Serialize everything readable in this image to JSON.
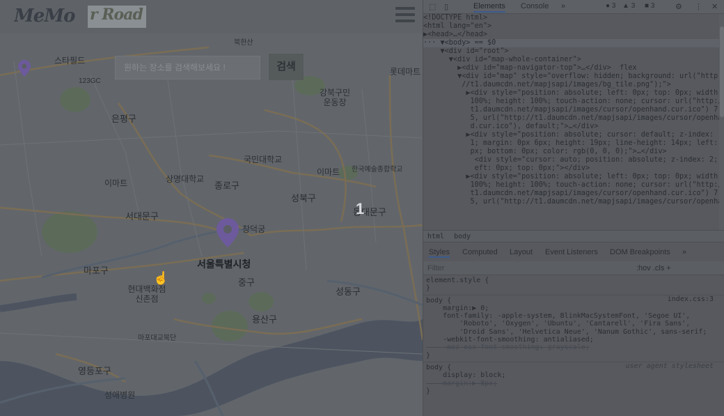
{
  "app": {
    "logo_text_1": "MeMo",
    "logo_text_2": "r Road",
    "search_placeholder": "원하는 장소를 검색해보세요 !",
    "search_button": "검색",
    "count_label": "1"
  },
  "map_labels": [
    {
      "text": "스타필드",
      "cls": "lbl"
    },
    {
      "text": "123GC",
      "cls": "lbl"
    },
    {
      "text": "이마트",
      "cls": "lbl"
    },
    {
      "text": "은평구",
      "cls": "lbl mid"
    },
    {
      "text": "국민대학교",
      "cls": "lbl"
    },
    {
      "text": "상명대학교",
      "cls": "lbl"
    },
    {
      "text": "종로구",
      "cls": "lbl mid"
    },
    {
      "text": "성북구",
      "cls": "lbl mid"
    },
    {
      "text": "서대문구",
      "cls": "lbl mid"
    },
    {
      "text": "창덕궁",
      "cls": "lbl"
    },
    {
      "text": "동대문구",
      "cls": "lbl mid"
    },
    {
      "text": "서울특별시청",
      "cls": "lbl big"
    },
    {
      "text": "마포구",
      "cls": "lbl mid"
    },
    {
      "text": "현대백화점 신촌점",
      "cls": "lbl"
    },
    {
      "text": "중구",
      "cls": "lbl mid"
    },
    {
      "text": "성동구",
      "cls": "lbl mid"
    },
    {
      "text": "영등포구",
      "cls": "lbl mid"
    },
    {
      "text": "용산구",
      "cls": "lbl mid"
    },
    {
      "text": "강북구민운동장",
      "cls": "lbl"
    },
    {
      "text": "롯데마트",
      "cls": "lbl"
    },
    {
      "text": "이마트",
      "cls": "lbl"
    },
    {
      "text": "한국예술종합학교",
      "cls": "lbl"
    },
    {
      "text": "성애병원",
      "cls": "lbl"
    },
    {
      "text": "마포대교북단",
      "cls": "lbl"
    },
    {
      "text": "북한산",
      "cls": "lbl"
    }
  ],
  "devtools": {
    "tabs": [
      "Elements",
      "Console"
    ],
    "more": "»",
    "errors": "3",
    "warnings": "3",
    "info": "3",
    "dom_lines": [
      "<!DOCTYPE html>",
      "<html lang=\"en\">",
      "▶<head>…</head>",
      "··· ▼<body> == $0",
      "    ▼<div id=\"root\">",
      "      ▼<div id=\"map-whole-container\">",
      "        ▶<div id=\"map-navigator-top\">…</div>  flex",
      "        ▼<div id=\"map\" style=\"overflow: hidden; background: url(\"http:",
      "         //t1.daumcdn.net/mapjsapi/images/bg_tile.png\");\">",
      "          ▶<div style=\"position: absolute; left: 0px; top: 0px; width:",
      "           100%; height: 100%; touch-action: none; cursor: url(\"http://",
      "           t1.daumcdn.net/mapjsapi/images/cursor/openhand.cur.ico\") 7",
      "           5, url(\"http://t1.daumcdn.net/mapjsapi/images/cursor/openhan",
      "           d.cur.ico\"), default;\">…</div>",
      "          ▶<div style=\"position: absolute; cursor: default; z-index:",
      "           1; margin: 0px 6px; height: 19px; line-height: 14px; left: 0",
      "           px; bottom: 0px; color: rgb(0, 0, 0);\">…</div>",
      "            <div style=\"cursor: auto; position: absolute; z-index: 2; l",
      "            eft: 0px; top: 0px;\"></div>",
      "          ▶<div style=\"position: absolute; left: 0px; top: 0px; width:",
      "           100%; height: 100%; touch-action: none; cursor: url(\"http://",
      "           t1.daumcdn.net/mapjsapi/images/cursor/openhand.cur.ico\") 7",
      "           5, url(\"http://t1.daumcdn.net/mapjsapi/images/cursor/openhan"
    ],
    "breadcrumbs": [
      "html",
      "body"
    ],
    "style_tabs": [
      "Styles",
      "Computed",
      "Layout",
      "Event Listeners",
      "DOM Breakpoints",
      "»"
    ],
    "filter_placeholder": "Filter",
    "filter_opts": ":hov  .cls  +",
    "styles_lines": [
      {
        "text": "element.style {",
        "src": ""
      },
      {
        "text": "}",
        "src": ""
      },
      {
        "text": "body {",
        "src": "index.css:3",
        "sep": true
      },
      {
        "text": "    margin:▶ 0;",
        "src": ""
      },
      {
        "text": "    font-family: -apple-system, BlinkMacSystemFont, 'Segoe UI',",
        "src": ""
      },
      {
        "text": "        'Roboto', 'Oxygen', 'Ubuntu', 'Cantarell', 'Fira Sans',",
        "src": ""
      },
      {
        "text": "        'Droid Sans', 'Helvetica Neue', 'Nanum Gothic', sans-serif;",
        "src": ""
      },
      {
        "text": "    -webkit-font-smoothing: antialiased;",
        "src": ""
      },
      {
        "text": "    -moz-osx-font-smoothing: grayscale;",
        "src": "",
        "strike": true
      },
      {
        "text": "}",
        "src": ""
      },
      {
        "text": "body {",
        "src": "user agent stylesheet",
        "sep": true,
        "ua": true
      },
      {
        "text": "    display: block;",
        "src": ""
      },
      {
        "text": "    margin:▶ 8px;",
        "src": "",
        "strike": true
      },
      {
        "text": "}",
        "src": ""
      }
    ]
  }
}
